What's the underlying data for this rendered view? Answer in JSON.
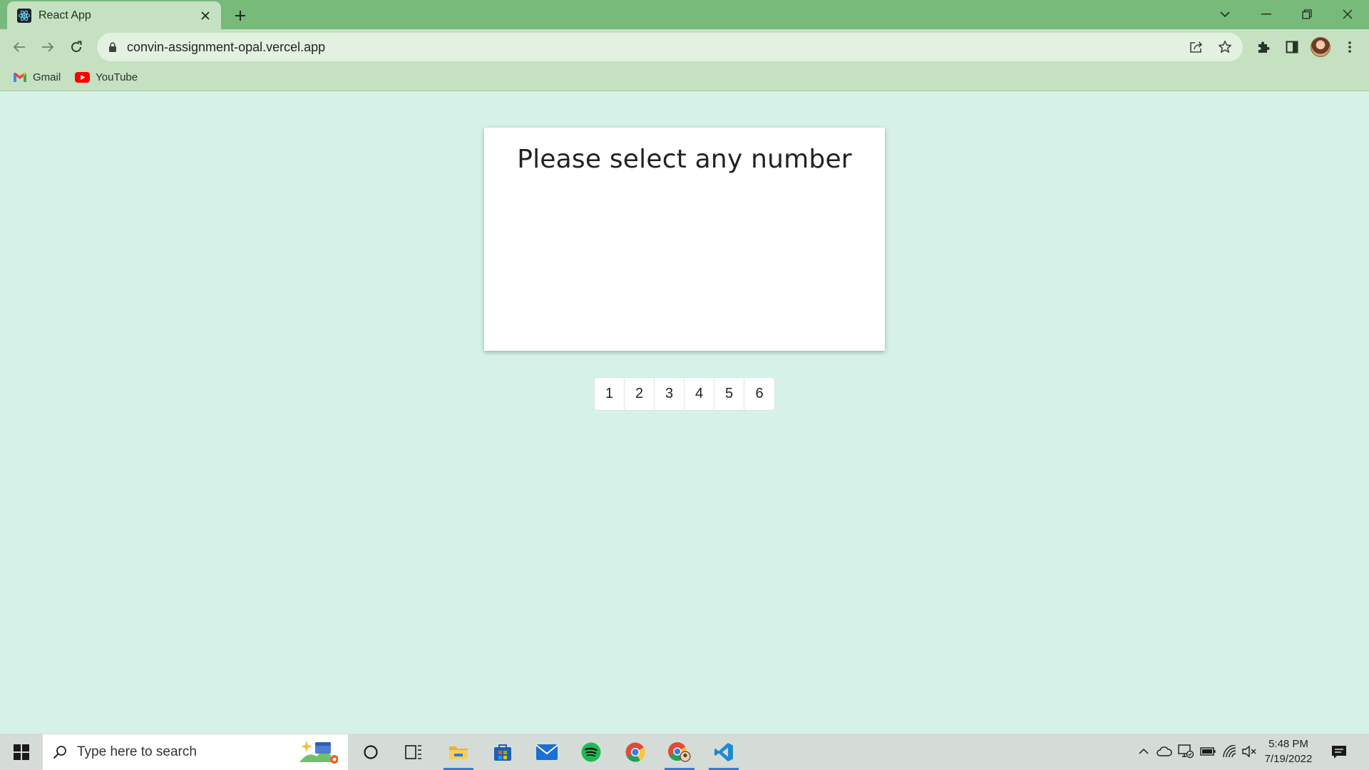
{
  "browser": {
    "tab": {
      "title": "React App"
    },
    "address_bar": {
      "url": "convin-assignment-opal.vercel.app"
    },
    "bookmarks": [
      {
        "label": "Gmail"
      },
      {
        "label": "YouTube"
      }
    ]
  },
  "app": {
    "prompt": "Please select any number",
    "pagination": [
      "1",
      "2",
      "3",
      "4",
      "5",
      "6"
    ]
  },
  "taskbar": {
    "search_placeholder": "Type here to search",
    "time": "5:48 PM",
    "date": "7/19/2022"
  },
  "colors": {
    "tab_strip": "#78ba79",
    "toolbar": "#c5e1c2",
    "page_background": "#d6f2e8",
    "card": "#ffffff",
    "taskbar": "#d5dcd7"
  }
}
